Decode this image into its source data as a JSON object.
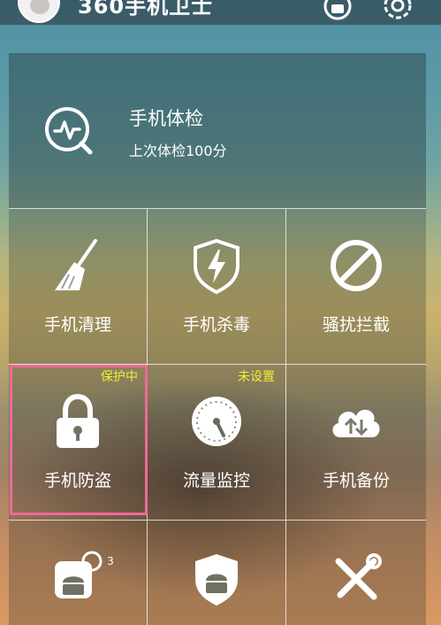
{
  "header": {
    "title": "360手机卫士",
    "medal_icon": "medal-icon",
    "settings_icon": "gear-icon"
  },
  "checkup": {
    "title": "手机体检",
    "subtitle": "上次体检100分",
    "icon": "checkup-magnifier-icon"
  },
  "tiles": [
    {
      "label": "手机清理",
      "icon": "broom-icon",
      "badge": ""
    },
    {
      "label": "手机杀毒",
      "icon": "shield-bolt-icon",
      "badge": ""
    },
    {
      "label": "骚扰拦截",
      "icon": "block-icon",
      "badge": ""
    },
    {
      "label": "手机防盗",
      "icon": "padlock-icon",
      "badge": "保护中"
    },
    {
      "label": "流量监控",
      "icon": "gauge-icon",
      "badge": "未设置"
    },
    {
      "label": "手机备份",
      "icon": "cloud-sync-icon",
      "badge": ""
    },
    {
      "label": "",
      "icon": "android-box-icon",
      "badge": "3"
    },
    {
      "label": "",
      "icon": "android-shield-icon",
      "badge": ""
    },
    {
      "label": "",
      "icon": "tools-icon",
      "badge": ""
    }
  ],
  "colors": {
    "badge_text": "#f2ec3c",
    "highlight": "#ee6b98"
  }
}
